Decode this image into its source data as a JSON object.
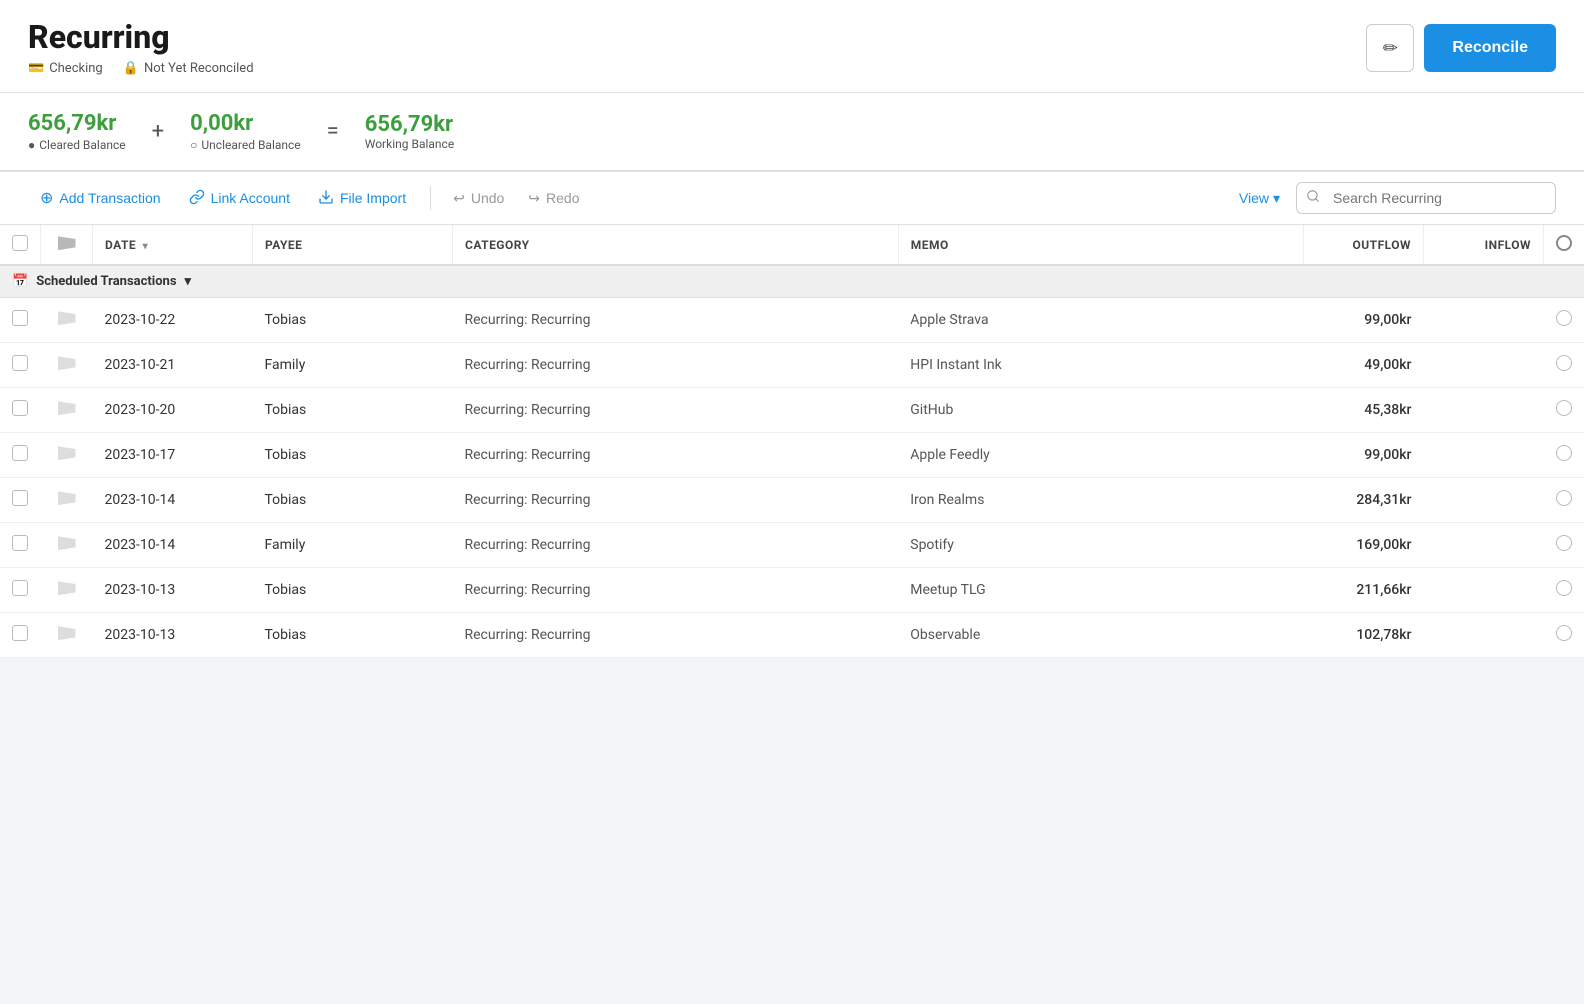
{
  "header": {
    "title": "Recurring",
    "account_label": "Checking",
    "reconcile_status": "Not Yet Reconciled",
    "edit_button_label": "✏",
    "reconcile_button_label": "Reconcile"
  },
  "balance": {
    "cleared_amount": "656,79kr",
    "cleared_label": "Cleared Balance",
    "cleared_icon": "●",
    "uncleared_amount": "0,00kr",
    "uncleared_label": "Uncleared Balance",
    "uncleared_icon": "○",
    "working_amount": "656,79kr",
    "working_label": "Working Balance",
    "op_plus": "+",
    "op_equals": "="
  },
  "toolbar": {
    "add_transaction_label": "Add Transaction",
    "link_account_label": "Link Account",
    "file_import_label": "File Import",
    "undo_label": "Undo",
    "redo_label": "Redo",
    "view_label": "View",
    "search_placeholder": "Search Recurring"
  },
  "table": {
    "columns": [
      "",
      "",
      "DATE",
      "PAYEE",
      "CATEGORY",
      "MEMO",
      "OUTFLOW",
      "INFLOW",
      "C"
    ],
    "group_label": "Scheduled Transactions",
    "rows": [
      {
        "date": "2023-10-22",
        "payee": "Tobias",
        "category": "Recurring: Recurring",
        "memo": "Apple Strava",
        "outflow": "99,00kr",
        "inflow": ""
      },
      {
        "date": "2023-10-21",
        "payee": "Family",
        "category": "Recurring: Recurring",
        "memo": "HPI Instant Ink",
        "outflow": "49,00kr",
        "inflow": ""
      },
      {
        "date": "2023-10-20",
        "payee": "Tobias",
        "category": "Recurring: Recurring",
        "memo": "GitHub",
        "outflow": "45,38kr",
        "inflow": ""
      },
      {
        "date": "2023-10-17",
        "payee": "Tobias",
        "category": "Recurring: Recurring",
        "memo": "Apple Feedly",
        "outflow": "99,00kr",
        "inflow": ""
      },
      {
        "date": "2023-10-14",
        "payee": "Tobias",
        "category": "Recurring: Recurring",
        "memo": "Iron Realms",
        "outflow": "284,31kr",
        "inflow": ""
      },
      {
        "date": "2023-10-14",
        "payee": "Family",
        "category": "Recurring: Recurring",
        "memo": "Spotify",
        "outflow": "169,00kr",
        "inflow": ""
      },
      {
        "date": "2023-10-13",
        "payee": "Tobias",
        "category": "Recurring: Recurring",
        "memo": "Meetup TLG",
        "outflow": "211,66kr",
        "inflow": ""
      },
      {
        "date": "2023-10-13",
        "payee": "Tobias",
        "category": "Recurring: Recurring",
        "memo": "Observable",
        "outflow": "102,78kr",
        "inflow": ""
      }
    ]
  },
  "icons": {
    "checking": "💳",
    "lock": "🔒",
    "add": "⊕",
    "link": "🔗",
    "import": "📥",
    "undo": "↩",
    "redo": "↪",
    "search": "🔍",
    "pencil": "✏",
    "calendar": "📅",
    "chevron_down": "▾"
  }
}
